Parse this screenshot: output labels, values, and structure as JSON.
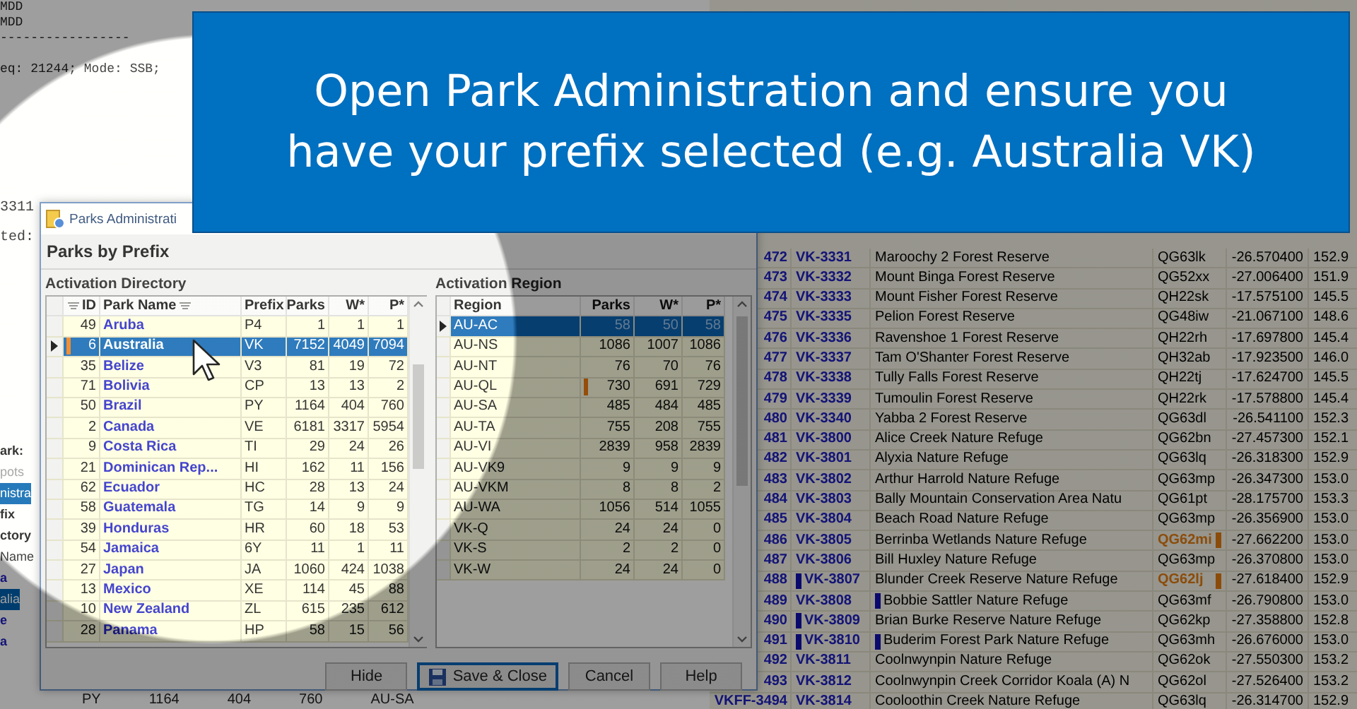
{
  "banner": {
    "lines": [
      "Open Park Administration and ensure you",
      "have your prefix selected (e.g. Australia VK)"
    ]
  },
  "background": {
    "console_lines": [
      "MDD",
      "MDD",
      "-----------------",
      "eq: 21244; Mode: SSB;"
    ],
    "console_tail": [
      "3311",
      "ted:"
    ],
    "side_labels": [
      {
        "text": "ark:",
        "kind": "label"
      },
      {
        "text": "pots",
        "kind": "muted"
      },
      {
        "text": "nistra",
        "kind": "selected"
      },
      {
        "text": "fix",
        "kind": "label"
      },
      {
        "text": "ctory",
        "kind": "label"
      },
      {
        "text": "Name",
        "kind": "plain"
      },
      {
        "text": "a",
        "kind": "link"
      },
      {
        "text": "alia",
        "kind": "selected"
      },
      {
        "text": "e",
        "kind": "link"
      },
      {
        "text": "a",
        "kind": "link"
      }
    ],
    "bottom_fragments": [
      "PY",
      "1164",
      "404",
      "760",
      "AU-SA"
    ],
    "park_rows": [
      {
        "number": "472",
        "ref": "VK-3331",
        "name": "Maroochy 2 Forest Reserve",
        "grid": "QG63lk",
        "lat": "-26.570400",
        "lon": "152.9",
        "ref_marked": false,
        "name_marked": false,
        "grid_warn": false
      },
      {
        "number": "473",
        "ref": "VK-3332",
        "name": "Mount Binga Forest Reserve",
        "grid": "QG52xx",
        "lat": "-27.006400",
        "lon": "151.9",
        "ref_marked": false,
        "name_marked": false,
        "grid_warn": false
      },
      {
        "number": "474",
        "ref": "VK-3333",
        "name": "Mount Fisher Forest Reserve",
        "grid": "QH22sk",
        "lat": "-17.575100",
        "lon": "145.5",
        "ref_marked": false,
        "name_marked": false,
        "grid_warn": false
      },
      {
        "number": "475",
        "ref": "VK-3335",
        "name": "Pelion Forest Reserve",
        "grid": "QG48iw",
        "lat": "-21.067100",
        "lon": "148.6",
        "ref_marked": false,
        "name_marked": false,
        "grid_warn": false
      },
      {
        "number": "476",
        "ref": "VK-3336",
        "name": "Ravenshoe 1 Forest Reserve",
        "grid": "QH22rh",
        "lat": "-17.697800",
        "lon": "145.4",
        "ref_marked": false,
        "name_marked": false,
        "grid_warn": false
      },
      {
        "number": "477",
        "ref": "VK-3337",
        "name": "Tam O'Shanter Forest Reserve",
        "grid": "QH32ab",
        "lat": "-17.923500",
        "lon": "146.0",
        "ref_marked": false,
        "name_marked": false,
        "grid_warn": false
      },
      {
        "number": "478",
        "ref": "VK-3338",
        "name": "Tully Falls Forest Reserve",
        "grid": "QH22tj",
        "lat": "-17.624700",
        "lon": "145.5",
        "ref_marked": false,
        "name_marked": false,
        "grid_warn": false
      },
      {
        "number": "479",
        "ref": "VK-3339",
        "name": "Tumoulin Forest Reserve",
        "grid": "QH22rk",
        "lat": "-17.578800",
        "lon": "145.4",
        "ref_marked": false,
        "name_marked": false,
        "grid_warn": false
      },
      {
        "number": "480",
        "ref": "VK-3340",
        "name": "Yabba 2 Forest Reserve",
        "grid": "QG63dl",
        "lat": "-26.541100",
        "lon": "152.3",
        "ref_marked": false,
        "name_marked": false,
        "grid_warn": false
      },
      {
        "number": "481",
        "ref": "VK-3800",
        "name": "Alice Creek Nature Refuge",
        "grid": "QG62bn",
        "lat": "-27.457300",
        "lon": "152.1",
        "ref_marked": false,
        "name_marked": false,
        "grid_warn": false
      },
      {
        "number": "482",
        "ref": "VK-3801",
        "name": "Alyxia Nature Refuge",
        "grid": "QG63lq",
        "lat": "-26.318300",
        "lon": "152.9",
        "ref_marked": false,
        "name_marked": false,
        "grid_warn": false
      },
      {
        "number": "483",
        "ref": "VK-3802",
        "name": "Arthur Harrold Nature Refuge",
        "grid": "QG63mp",
        "lat": "-26.347300",
        "lon": "153.0",
        "ref_marked": false,
        "name_marked": false,
        "grid_warn": false
      },
      {
        "number": "484",
        "ref": "VK-3803",
        "name": "Bally Mountain Conservation Area Natu",
        "grid": "QG61pt",
        "lat": "-28.175700",
        "lon": "153.3",
        "ref_marked": false,
        "name_marked": false,
        "grid_warn": false
      },
      {
        "number": "485",
        "ref": "VK-3804",
        "name": "Beach Road Nature Refuge",
        "grid": "QG63mp",
        "lat": "-26.356900",
        "lon": "153.0",
        "ref_marked": false,
        "name_marked": false,
        "grid_warn": false
      },
      {
        "number": "486",
        "ref": "VK-3805",
        "name": "Berrinba Wetlands Nature Refuge",
        "grid": "QG62mi",
        "lat": "-27.662200",
        "lon": "153.0",
        "ref_marked": false,
        "name_marked": false,
        "grid_warn": true
      },
      {
        "number": "487",
        "ref": "VK-3806",
        "name": "Bill Huxley Nature Refuge",
        "grid": "QG63mp",
        "lat": "-26.370800",
        "lon": "153.0",
        "ref_marked": false,
        "name_marked": false,
        "grid_warn": false
      },
      {
        "number": "488",
        "ref": "VK-3807",
        "name": "Blunder Creek Reserve Nature Refuge",
        "grid": "QG62lj",
        "lat": "-27.618400",
        "lon": "152.9",
        "ref_marked": true,
        "name_marked": false,
        "grid_warn": true
      },
      {
        "number": "489",
        "ref": "VK-3808",
        "name": "Bobbie Sattler Nature Refuge",
        "grid": "QG63mf",
        "lat": "-26.790800",
        "lon": "153.0",
        "ref_marked": false,
        "name_marked": true,
        "grid_warn": false
      },
      {
        "number": "490",
        "ref": "VK-3809",
        "name": "Brian Burke Reserve Nature Refuge",
        "grid": "QG62kp",
        "lat": "-27.358800",
        "lon": "152.8",
        "ref_marked": true,
        "name_marked": false,
        "grid_warn": false
      },
      {
        "number": "491",
        "ref": "VK-3810",
        "name": "Buderim Forest Park Nature Refuge",
        "grid": "QG63mh",
        "lat": "-26.676000",
        "lon": "153.0",
        "ref_marked": true,
        "name_marked": true,
        "grid_warn": false
      },
      {
        "number": "492",
        "ref": "VK-3811",
        "name": "Coolnwynpin Nature Refuge",
        "grid": "QG62ok",
        "lat": "-27.550300",
        "lon": "153.2",
        "ref_marked": false,
        "name_marked": false,
        "grid_warn": false
      },
      {
        "number": "493",
        "ref": "VK-3812",
        "name": "Coolnwynpin Creek Corridor Koala (A) N",
        "grid": "QG62ol",
        "lat": "-27.526400",
        "lon": "153.2",
        "ref_marked": false,
        "name_marked": false,
        "grid_warn": false
      },
      {
        "number": "VKFF-3494",
        "ref": "VK-3814",
        "name": "Cooloothin Creek Nature Refuge",
        "grid": "QG63lq",
        "lat": "-26.314700",
        "lon": "152.9",
        "ref_marked": false,
        "name_marked": false,
        "grid_warn": false
      }
    ]
  },
  "dialog": {
    "title": "Parks Administrati",
    "heading": "Parks by Prefix",
    "directory": {
      "title": "Activation Directory",
      "columns": [
        "ID",
        "Park Name",
        "Prefix",
        "Parks",
        "W*",
        "P*"
      ],
      "rows": [
        {
          "id": "49",
          "name": "Aruba",
          "prefix": "P4",
          "parks": "1",
          "w": "1",
          "p": "1",
          "selected": false,
          "flag": false
        },
        {
          "id": "6",
          "name": "Australia",
          "prefix": "VK",
          "parks": "7152",
          "w": "4049",
          "p": "7094",
          "selected": true,
          "flag": true
        },
        {
          "id": "35",
          "name": "Belize",
          "prefix": "V3",
          "parks": "81",
          "w": "19",
          "p": "72",
          "selected": false,
          "flag": false
        },
        {
          "id": "71",
          "name": "Bolivia",
          "prefix": "CP",
          "parks": "13",
          "w": "13",
          "p": "2",
          "selected": false,
          "flag": false
        },
        {
          "id": "50",
          "name": "Brazil",
          "prefix": "PY",
          "parks": "1164",
          "w": "404",
          "p": "760",
          "selected": false,
          "flag": false
        },
        {
          "id": "2",
          "name": "Canada",
          "prefix": "VE",
          "parks": "6181",
          "w": "3317",
          "p": "5954",
          "selected": false,
          "flag": false
        },
        {
          "id": "9",
          "name": "Costa Rica",
          "prefix": "TI",
          "parks": "29",
          "w": "24",
          "p": "26",
          "selected": false,
          "flag": false
        },
        {
          "id": "21",
          "name": "Dominican Rep...",
          "prefix": "HI",
          "parks": "162",
          "w": "11",
          "p": "156",
          "selected": false,
          "flag": false
        },
        {
          "id": "62",
          "name": "Ecuador",
          "prefix": "HC",
          "parks": "28",
          "w": "13",
          "p": "24",
          "selected": false,
          "flag": false
        },
        {
          "id": "58",
          "name": "Guatemala",
          "prefix": "TG",
          "parks": "14",
          "w": "9",
          "p": "9",
          "selected": false,
          "flag": false
        },
        {
          "id": "39",
          "name": "Honduras",
          "prefix": "HR",
          "parks": "60",
          "w": "18",
          "p": "53",
          "selected": false,
          "flag": false
        },
        {
          "id": "54",
          "name": "Jamaica",
          "prefix": "6Y",
          "parks": "11",
          "w": "1",
          "p": "11",
          "selected": false,
          "flag": false
        },
        {
          "id": "27",
          "name": "Japan",
          "prefix": "JA",
          "parks": "1060",
          "w": "424",
          "p": "1038",
          "selected": false,
          "flag": false
        },
        {
          "id": "13",
          "name": "Mexico",
          "prefix": "XE",
          "parks": "114",
          "w": "45",
          "p": "88",
          "selected": false,
          "flag": false
        },
        {
          "id": "10",
          "name": "New Zealand",
          "prefix": "ZL",
          "parks": "615",
          "w": "235",
          "p": "612",
          "selected": false,
          "flag": false
        },
        {
          "id": "28",
          "name": "Panama",
          "prefix": "HP",
          "parks": "58",
          "w": "15",
          "p": "56",
          "selected": false,
          "flag": false
        }
      ]
    },
    "region": {
      "title": "Activation Region",
      "columns": [
        "Region",
        "Parks",
        "W*",
        "P*"
      ],
      "rows": [
        {
          "region": "AU-AC",
          "parks": "58",
          "w": "50",
          "p": "58",
          "selected": true,
          "flag": false
        },
        {
          "region": "AU-NS",
          "parks": "1086",
          "w": "1007",
          "p": "1086",
          "selected": false,
          "flag": false
        },
        {
          "region": "AU-NT",
          "parks": "76",
          "w": "70",
          "p": "76",
          "selected": false,
          "flag": false
        },
        {
          "region": "AU-QL",
          "parks": "730",
          "w": "691",
          "p": "729",
          "selected": false,
          "flag": true
        },
        {
          "region": "AU-SA",
          "parks": "485",
          "w": "484",
          "p": "485",
          "selected": false,
          "flag": false
        },
        {
          "region": "AU-TA",
          "parks": "755",
          "w": "208",
          "p": "755",
          "selected": false,
          "flag": false
        },
        {
          "region": "AU-VI",
          "parks": "2839",
          "w": "958",
          "p": "2839",
          "selected": false,
          "flag": false
        },
        {
          "region": "AU-VK9",
          "parks": "9",
          "w": "9",
          "p": "9",
          "selected": false,
          "flag": false
        },
        {
          "region": "AU-VKM",
          "parks": "8",
          "w": "8",
          "p": "2",
          "selected": false,
          "flag": false
        },
        {
          "region": "AU-WA",
          "parks": "1056",
          "w": "514",
          "p": "1055",
          "selected": false,
          "flag": false
        },
        {
          "region": "VK-Q",
          "parks": "24",
          "w": "24",
          "p": "0",
          "selected": false,
          "flag": false
        },
        {
          "region": "VK-S",
          "parks": "2",
          "w": "2",
          "p": "0",
          "selected": false,
          "flag": false
        },
        {
          "region": "VK-W",
          "parks": "24",
          "w": "24",
          "p": "0",
          "selected": false,
          "flag": false
        }
      ]
    },
    "buttons": [
      {
        "label": "Hide",
        "kind": "plain"
      },
      {
        "label": "Save & Close",
        "kind": "save"
      },
      {
        "label": "Cancel",
        "kind": "plain"
      },
      {
        "label": "Help",
        "kind": "plain"
      }
    ]
  }
}
